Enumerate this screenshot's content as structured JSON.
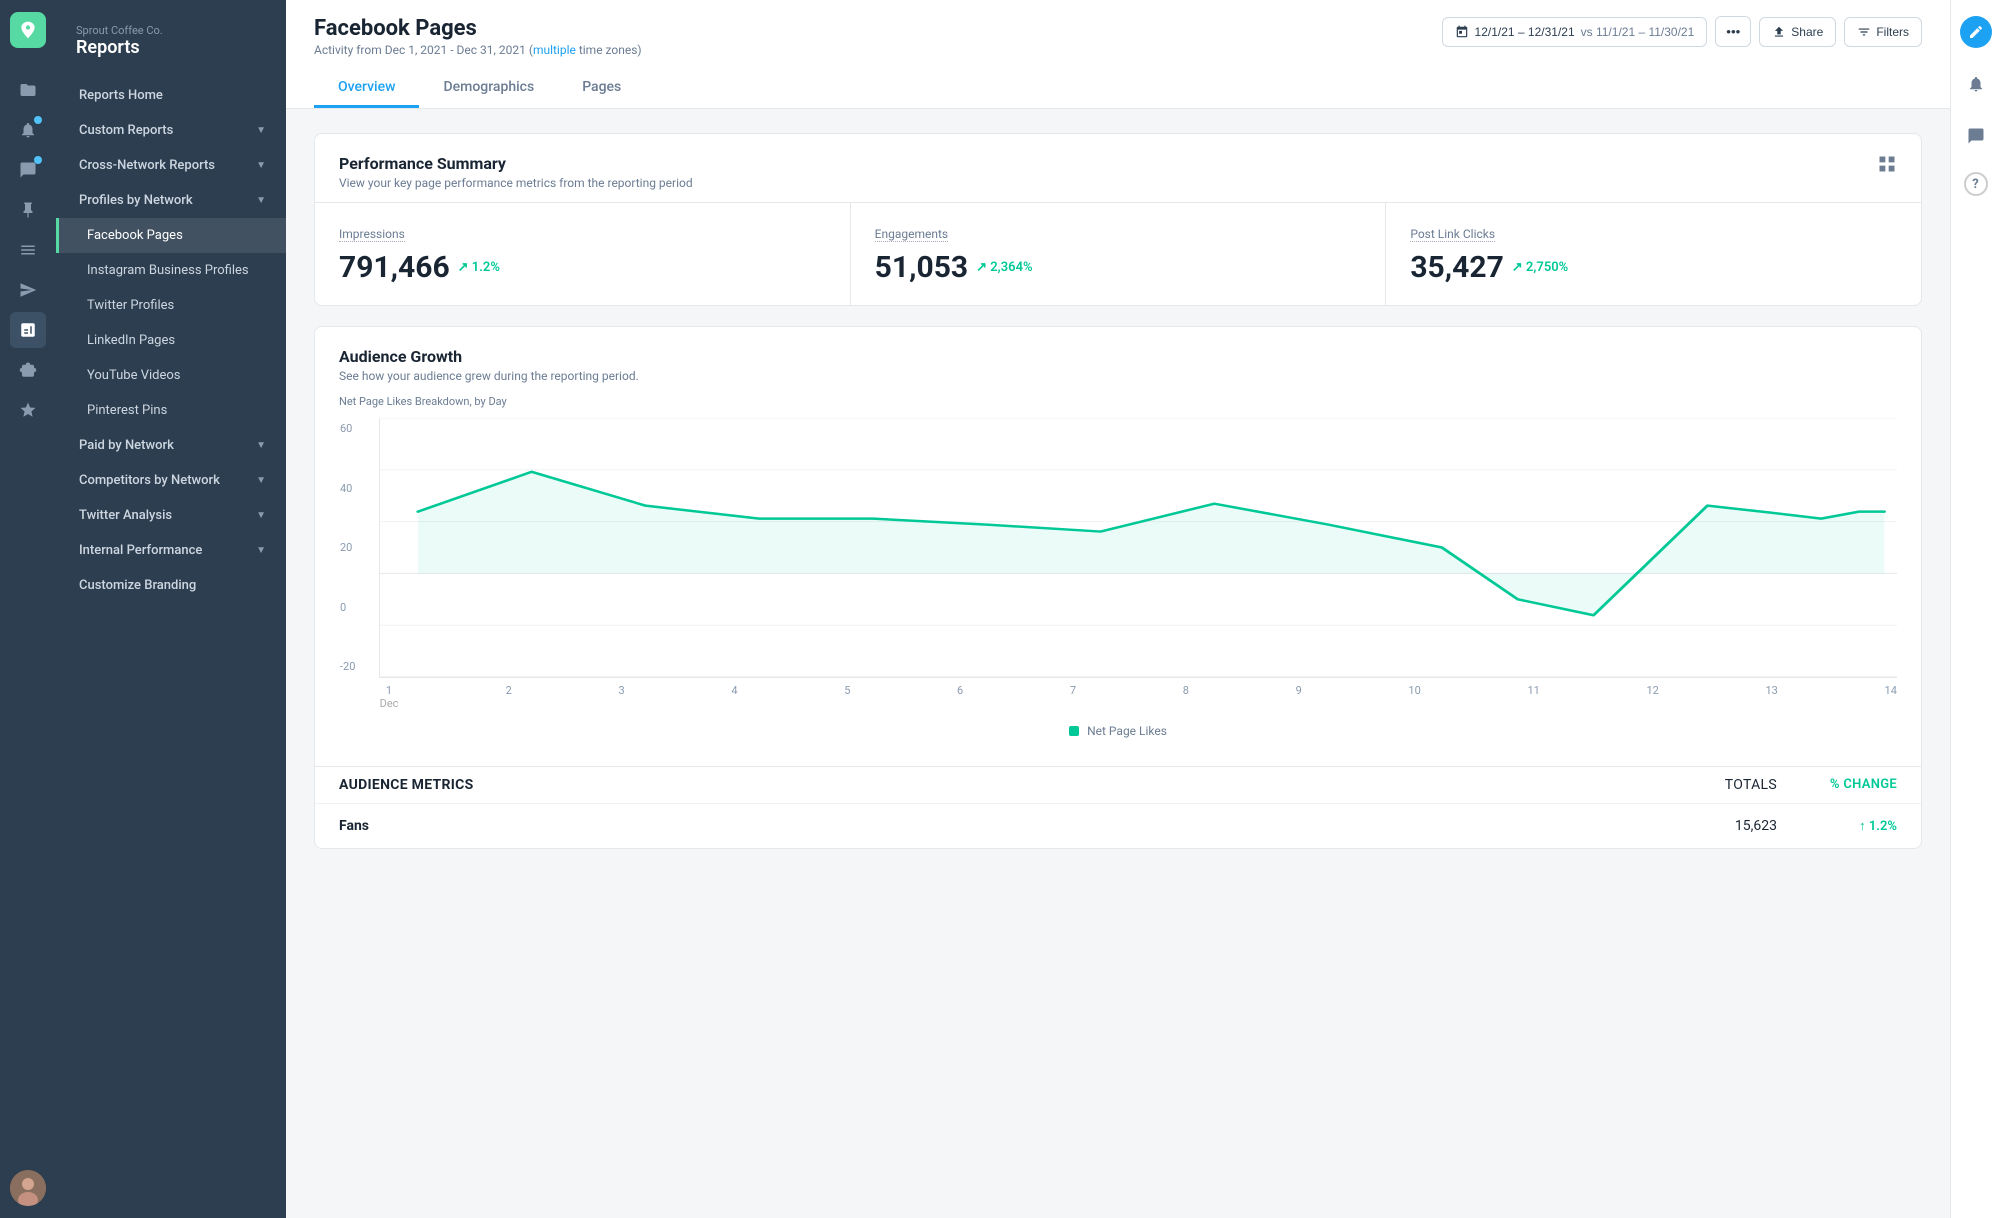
{
  "app": {
    "company": "Sprout Coffee Co.",
    "section": "Reports"
  },
  "sidebar": {
    "items": [
      {
        "id": "reports-home",
        "label": "Reports Home",
        "active": false,
        "sub": false,
        "hasChevron": false
      },
      {
        "id": "custom-reports",
        "label": "Custom Reports",
        "active": false,
        "sub": false,
        "hasChevron": true
      },
      {
        "id": "cross-network",
        "label": "Cross-Network Reports",
        "active": false,
        "sub": false,
        "hasChevron": true
      },
      {
        "id": "profiles-by-network",
        "label": "Profiles by Network",
        "active": false,
        "sub": false,
        "hasChevron": true
      },
      {
        "id": "facebook-pages",
        "label": "Facebook Pages",
        "active": true,
        "sub": true,
        "hasChevron": false
      },
      {
        "id": "instagram-business",
        "label": "Instagram Business Profiles",
        "active": false,
        "sub": true,
        "hasChevron": false
      },
      {
        "id": "twitter-profiles",
        "label": "Twitter Profiles",
        "active": false,
        "sub": true,
        "hasChevron": false
      },
      {
        "id": "linkedin-pages",
        "label": "LinkedIn Pages",
        "active": false,
        "sub": true,
        "hasChevron": false
      },
      {
        "id": "youtube-videos",
        "label": "YouTube Videos",
        "active": false,
        "sub": true,
        "hasChevron": false
      },
      {
        "id": "pinterest-pins",
        "label": "Pinterest Pins",
        "active": false,
        "sub": true,
        "hasChevron": false
      },
      {
        "id": "paid-by-network",
        "label": "Paid by Network",
        "active": false,
        "sub": false,
        "hasChevron": true
      },
      {
        "id": "competitors-by-network",
        "label": "Competitors by Network",
        "active": false,
        "sub": false,
        "hasChevron": true
      },
      {
        "id": "twitter-analysis",
        "label": "Twitter Analysis",
        "active": false,
        "sub": false,
        "hasChevron": true
      },
      {
        "id": "internal-performance",
        "label": "Internal Performance",
        "active": false,
        "sub": false,
        "hasChevron": true
      },
      {
        "id": "customize-branding",
        "label": "Customize Branding",
        "active": false,
        "sub": false,
        "hasChevron": false
      }
    ]
  },
  "header": {
    "title": "Facebook Pages",
    "subtitle_prefix": "Activity from Dec 1, 2021 - Dec 31, 2021 (",
    "subtitle_link": "multiple",
    "subtitle_suffix": " time zones)",
    "date_range": "12/1/21 – 12/31/21",
    "comparison": "vs 11/1/21 – 11/30/21",
    "share_label": "Share",
    "filters_label": "Filters"
  },
  "tabs": [
    {
      "id": "overview",
      "label": "Overview",
      "active": true
    },
    {
      "id": "demographics",
      "label": "Demographics",
      "active": false
    },
    {
      "id": "pages",
      "label": "Pages",
      "active": false
    }
  ],
  "performance_summary": {
    "title": "Performance Summary",
    "subtitle": "View your key page performance metrics from the reporting period",
    "metrics": [
      {
        "label": "Impressions",
        "value": "791,466",
        "change": "1.2%"
      },
      {
        "label": "Engagements",
        "value": "51,053",
        "change": "2,364%"
      },
      {
        "label": "Post Link Clicks",
        "value": "35,427",
        "change": "2,750%"
      }
    ]
  },
  "audience_growth": {
    "title": "Audience Growth",
    "subtitle": "See how your audience grew during the reporting period.",
    "chart_label": "Net Page Likes Breakdown, by Day",
    "y_axis": [
      "60",
      "40",
      "20",
      "0",
      "-20"
    ],
    "x_axis": [
      {
        "label": "1",
        "sublabel": "Dec"
      },
      {
        "label": "2",
        "sublabel": ""
      },
      {
        "label": "3",
        "sublabel": ""
      },
      {
        "label": "4",
        "sublabel": ""
      },
      {
        "label": "5",
        "sublabel": ""
      },
      {
        "label": "6",
        "sublabel": ""
      },
      {
        "label": "7",
        "sublabel": ""
      },
      {
        "label": "8",
        "sublabel": ""
      },
      {
        "label": "9",
        "sublabel": ""
      },
      {
        "label": "10",
        "sublabel": ""
      },
      {
        "label": "11",
        "sublabel": ""
      },
      {
        "label": "12",
        "sublabel": ""
      },
      {
        "label": "13",
        "sublabel": ""
      },
      {
        "label": "14",
        "sublabel": ""
      }
    ],
    "legend": "Net Page Likes",
    "legend_color": "#00c896"
  },
  "audience_metrics": {
    "columns": [
      "Audience Metrics",
      "Totals",
      "% Change"
    ],
    "rows": [
      {
        "label": "Fans",
        "total": "15,623",
        "change": "↑ 1.2%"
      }
    ]
  },
  "icons": {
    "logo": "🌱",
    "calendar": "📅",
    "share": "↑",
    "filters": "≡",
    "grid": "⊞",
    "dots": "•••",
    "compose": "✏️",
    "bell": "🔔",
    "chat": "💬",
    "help": "?"
  }
}
